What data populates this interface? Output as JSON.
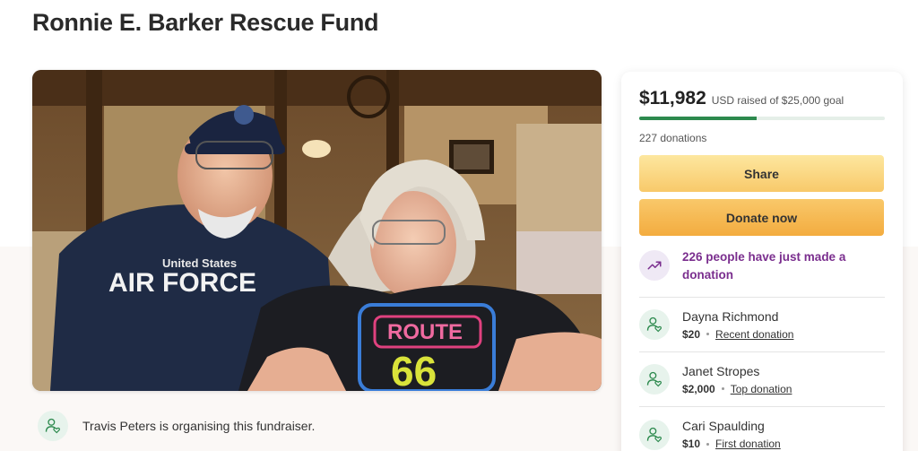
{
  "page": {
    "title": "Ronnie E. Barker Rescue Fund"
  },
  "hero": {
    "image_description": "Photo of an older couple smiling in a restaurant",
    "shirt_left": "AIR FORCE",
    "shirt_left_top": "United States",
    "shirt_right": "ROUTE",
    "shirt_right_number": "66"
  },
  "organiser": {
    "text": "Travis Peters is organising this fundraiser.",
    "icon": "person-heart-icon"
  },
  "donation_panel": {
    "raised": "$11,982",
    "goal_text": "USD raised of $25,000 goal",
    "progress_fraction": 0.479,
    "donations_count": "227 donations",
    "share_label": "Share",
    "donate_label": "Donate now",
    "trend_text": "226 people have just made a donation",
    "trend_icon": "trending-up-icon",
    "donors": [
      {
        "name": "Dayna Richmond",
        "amount": "$20",
        "tag": "Recent donation"
      },
      {
        "name": "Janet Stropes",
        "amount": "$2,000",
        "tag": "Top donation"
      },
      {
        "name": "Cari Spaulding",
        "amount": "$10",
        "tag": "First donation"
      }
    ]
  },
  "colors": {
    "progress": "#2d8a4e",
    "trend_text": "#7a2e8e",
    "share_button": "#f8c96a",
    "donate_button": "#f3ac3f"
  }
}
